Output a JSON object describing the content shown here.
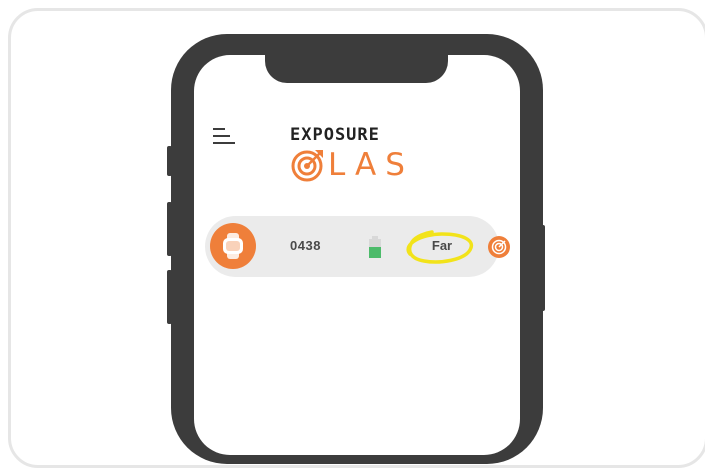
{
  "app": {
    "brand_line1": "EXPOSURE",
    "brand_line2": "LAS",
    "brand_color": "#ef7f3a"
  },
  "header": {
    "menu_icon": "hamburger-menu-icon"
  },
  "device": {
    "icon": "smartwatch-icon",
    "id": "0438",
    "battery_level": 0.6,
    "battery_color": "#4cbb6a",
    "distance": "Far",
    "highlight_color": "#f2e31a",
    "action_icon": "target-icon"
  }
}
